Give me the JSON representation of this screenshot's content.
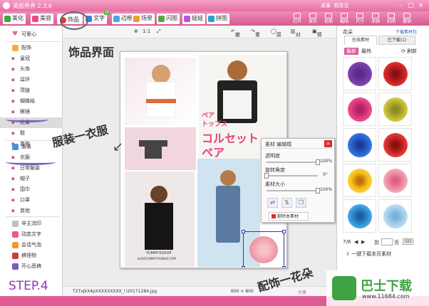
{
  "app": {
    "title": "美图秀秀 2.3.6",
    "account_label": "桌果",
    "feedback_label": "我意见",
    "minimize": "–",
    "maximize": "□",
    "close": "×"
  },
  "tabs": [
    {
      "label": "美化",
      "color": "#3fa340"
    },
    {
      "label": "美容",
      "color": "#e94b8b"
    },
    {
      "label": "饰品",
      "color": "#d93b3b"
    },
    {
      "label": "文字",
      "color": "#3b7fd6"
    },
    {
      "label": "边框",
      "color": "#4ca7d8"
    },
    {
      "label": "场景",
      "color": "#e8a12d"
    },
    {
      "label": "闪图",
      "color": "#5aa84a"
    },
    {
      "label": "娃娃",
      "color": "#b45ad2"
    },
    {
      "label": "拼图",
      "color": "#2da0c9"
    }
  ],
  "tab_badge": "18",
  "toolbar_buttons": [
    "打开",
    "保存",
    "抠图",
    "截图",
    "尺寸",
    "涂鸦",
    "拍照",
    "撤销"
  ],
  "sidebar": {
    "items": [
      {
        "label": "可爱心",
        "group": true
      },
      {
        "label": "配饰",
        "group": true
      },
      {
        "label": "皇冠"
      },
      {
        "label": "头饰"
      },
      {
        "label": "耳环"
      },
      {
        "label": "项链"
      },
      {
        "label": "蝴蝶结"
      },
      {
        "label": "眼镜"
      },
      {
        "label": "花朵",
        "selected": true
      },
      {
        "label": "鞋"
      },
      {
        "label": "其他"
      },
      {
        "label": "服装",
        "group": true
      },
      {
        "label": "衣服"
      },
      {
        "label": "日常服装"
      },
      {
        "label": "帽子"
      },
      {
        "label": "围巾"
      },
      {
        "label": "口罩"
      },
      {
        "label": "其他"
      },
      {
        "label": "非主流印",
        "group": true
      },
      {
        "label": "动态文字",
        "group": true
      },
      {
        "label": "会话气泡",
        "group": true
      },
      {
        "label": "搞怪物",
        "group": true
      },
      {
        "label": "开心恶搞",
        "group": true
      }
    ]
  },
  "canvas_bar": {
    "zoom_label": "1:1",
    "undo": "撤销",
    "redo": "重做",
    "original": "原图",
    "compare": "对比",
    "preview": "预览"
  },
  "photo": {
    "text_jp1": "ペア",
    "text_jp2": "トップス",
    "text_jp3": "コルセット",
    "text_jp4": "ペア",
    "shop_name": "YUMMYSSHOP",
    "shop_url": "ILOVEYUMMY.TAOBAO.COM"
  },
  "material_panel": {
    "title": "素材 编辑框",
    "transparency_label": "透明度",
    "transparency_value": "100%",
    "rotate_label": "旋转角度",
    "rotate_value": "0°",
    "size_label": "素材大小",
    "size_value": "100%",
    "delete_label": "删除本素材",
    "transparency_level": 1.0,
    "rotate_level": 0.0,
    "size_level": 1.0
  },
  "status_bar": {
    "filename": "T2TxJkX4pXXXXXXXXX_!!20171284.jpg",
    "dimensions": "600 × 800",
    "label": "分享"
  },
  "right_panel": {
    "category": "花朵",
    "download_link": "下载素材包",
    "tab_online": "在线素材",
    "tab_downloaded": "已下载",
    "downloaded_count": "1",
    "subtab_new": "最新",
    "subtab_hot": "最热",
    "refresh": "刷新",
    "pager": "7/8",
    "goto_label": "到",
    "page_label": "页",
    "go_button": "GO",
    "download_all": "一键下载本页素材",
    "swatch_colors": [
      "#7a3ea8",
      "#d62828",
      "#e8458a",
      "#c6c23a",
      "#2f6fd8",
      "#e03232",
      "#f6c21a",
      "#f0a0b0",
      "#3aa0e0",
      "#b0d8f0"
    ]
  },
  "annotations": {
    "accessory_ui": "饰品界面",
    "clothing": "服装一衣服",
    "accessory_flower": "配饰一花朵",
    "step": "STEP.4"
  },
  "watermark": {
    "name": "巴士下载",
    "url": "www.11684.com"
  }
}
